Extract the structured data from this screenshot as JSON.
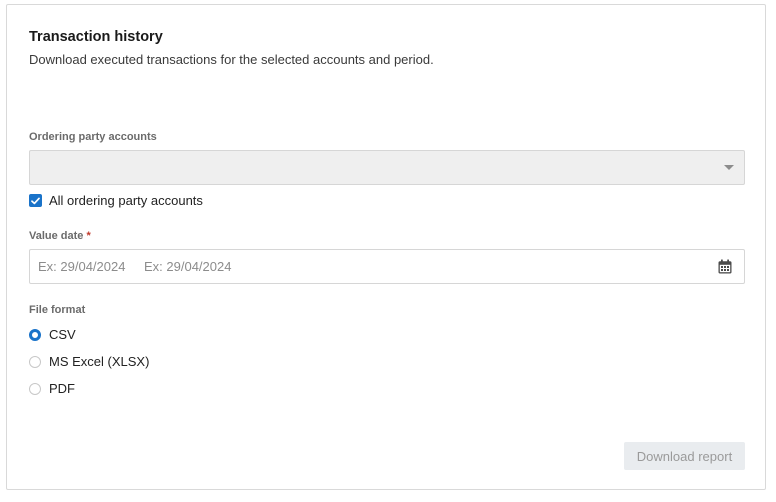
{
  "header": {
    "title": "Transaction history",
    "subtitle": "Download executed transactions for the selected accounts and period."
  },
  "accounts": {
    "label": "Ordering party accounts",
    "selected_value": "",
    "all_accounts_label": "All ordering party accounts",
    "all_accounts_checked": true
  },
  "value_date": {
    "label": "Value date",
    "required_marker": "*",
    "from_placeholder": "Ex: 29/04/2024",
    "to_placeholder": "Ex: 29/04/2024"
  },
  "file_format": {
    "label": "File format",
    "options": [
      {
        "label": "CSV",
        "checked": true
      },
      {
        "label": "MS Excel (XLSX)",
        "checked": false
      },
      {
        "label": "PDF",
        "checked": false
      }
    ]
  },
  "actions": {
    "download_label": "Download report"
  },
  "colors": {
    "accent": "#1a73c9",
    "required": "#c0392b",
    "disabled_button_bg": "#e9ecef"
  },
  "icons": {
    "select_caret": "chevron-down-icon",
    "checkbox_check": "check-icon",
    "date_picker": "calendar-icon"
  }
}
